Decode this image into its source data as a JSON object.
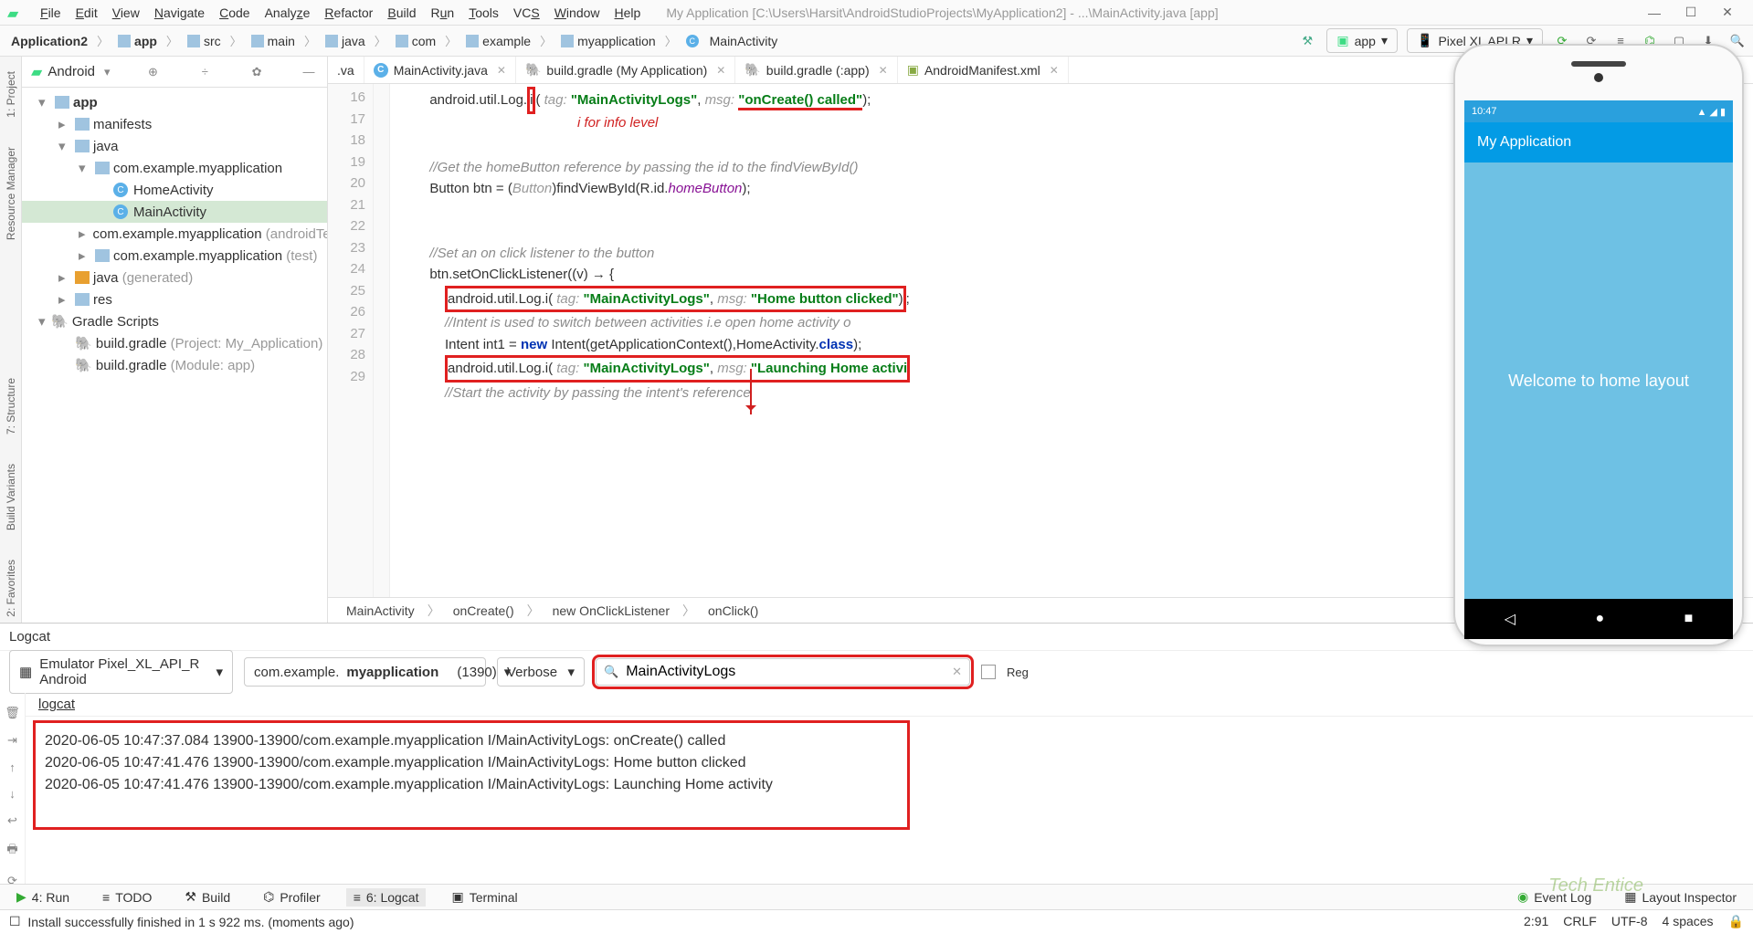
{
  "window": {
    "title": "My Application [C:\\Users\\Harsit\\AndroidStudioProjects\\MyApplication2] - ...\\MainActivity.java [app]"
  },
  "menu": [
    "File",
    "Edit",
    "View",
    "Navigate",
    "Code",
    "Analyze",
    "Refactor",
    "Build",
    "Run",
    "Tools",
    "VCS",
    "Window",
    "Help"
  ],
  "breadcrumbs": [
    "Application2",
    "app",
    "src",
    "main",
    "java",
    "com",
    "example",
    "myapplication",
    "MainActivity"
  ],
  "toolbar": {
    "config": "app",
    "device": "Pixel XL API R"
  },
  "sidetabs": {
    "project": "1: Project",
    "resmgr": "Resource Manager",
    "structure": "7: Structure",
    "buildvar": "Build Variants",
    "fav": "2: Favorites"
  },
  "project": {
    "header": "Android",
    "app": "app",
    "manifests": "manifests",
    "java": "java",
    "pkg": "com.example.myapplication",
    "home": "HomeActivity",
    "main": "MainActivity",
    "pkgTest": "com.example.myapplication",
    "pkgTestSuffix": "(androidTe",
    "pkgUnit": "com.example.myapplication",
    "pkgUnitSuffix": "(test)",
    "javagen": "java",
    "javagenSuffix": "(generated)",
    "res": "res",
    "gradle": "Gradle Scripts",
    "bg1": "build.gradle",
    "bg1s": "(Project: My_Application)",
    "bg2": "build.gradle",
    "bg2s": "(Module: app)"
  },
  "tabs": [
    {
      "label": ".va"
    },
    {
      "label": "MainActivity.java",
      "type": "c"
    },
    {
      "label": "build.gradle (My Application)",
      "type": "g"
    },
    {
      "label": "build.gradle (:app)",
      "type": "g"
    },
    {
      "label": "AndroidManifest.xml",
      "type": "m"
    }
  ],
  "lines": [
    "16",
    "17",
    "18",
    "19",
    "20",
    "21",
    "22",
    "23",
    "24",
    "25",
    "26",
    "27",
    "28",
    "29"
  ],
  "annotation": "i for info level",
  "code_nav": [
    "MainActivity",
    "onCreate()",
    "new OnClickListener",
    "onClick()"
  ],
  "logcat": {
    "title": "Logcat",
    "device": "Emulator Pixel_XL_API_R Android",
    "pkg": "com.example.",
    "pkgB": "myapplication",
    "pid": "(1390)",
    "level": "Verbose",
    "search": "MainActivityLogs",
    "regex": "Reg",
    "sub": "logcat",
    "lines": [
      "2020-06-05 10:47:37.084 13900-13900/com.example.myapplication I/MainActivityLogs: onCreate() called",
      "2020-06-05 10:47:41.476 13900-13900/com.example.myapplication I/MainActivityLogs: Home button clicked",
      "2020-06-05 10:47:41.476 13900-13900/com.example.myapplication I/MainActivityLogs: Launching Home activity"
    ]
  },
  "bottom": {
    "run": "4: Run",
    "todo": "TODO",
    "build": "Build",
    "profiler": "Profiler",
    "logcat": "6: Logcat",
    "terminal": "Terminal",
    "eventlog": "Event Log",
    "layout": "Layout Inspector"
  },
  "status": {
    "msg": "Install successfully finished in 1 s 922 ms. (moments ago)",
    "pos": "2:91",
    "crlf": "CRLF",
    "enc": "UTF-8",
    "spaces": "4 spaces"
  },
  "emulator": {
    "time": "10:47",
    "appbar": "My Application",
    "body": "Welcome to home layout"
  },
  "watermark": "Tech Entice"
}
